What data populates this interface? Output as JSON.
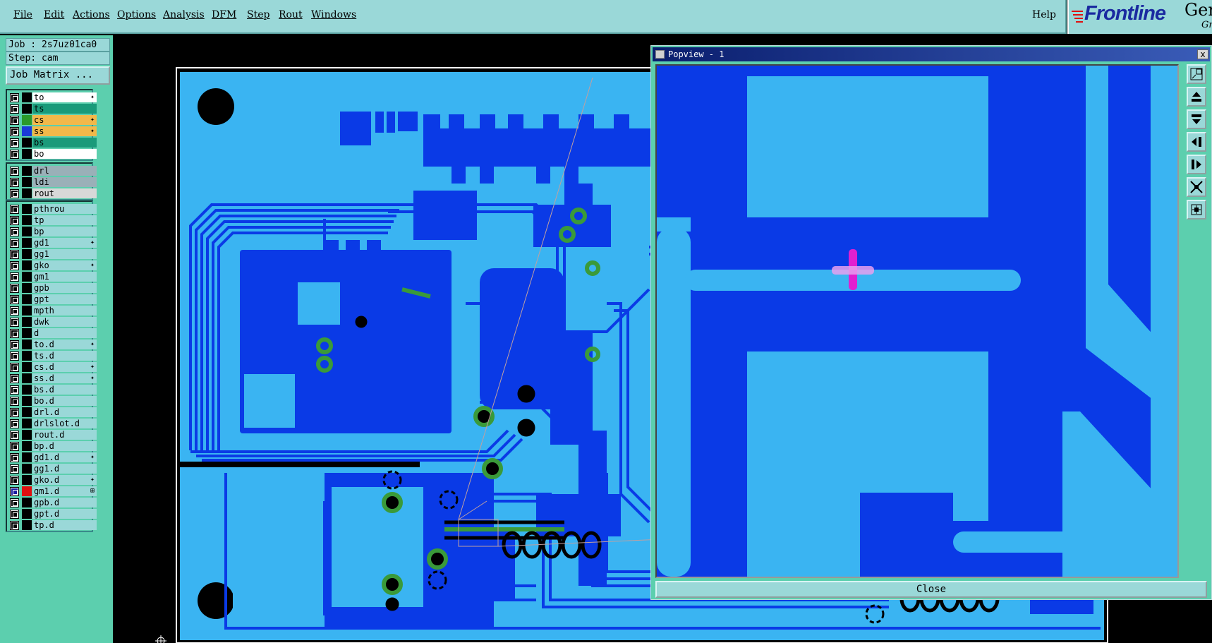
{
  "menu": {
    "items": [
      {
        "label": "File"
      },
      {
        "label": "Edit"
      },
      {
        "label": "Actions"
      },
      {
        "label": "Options"
      },
      {
        "label": "Analysis"
      },
      {
        "label": "DFM"
      },
      {
        "label": "Step"
      },
      {
        "label": "Rout"
      },
      {
        "label": "Windows"
      }
    ],
    "help": "Help"
  },
  "logo": {
    "brand": "Frontline",
    "product": "Ger",
    "sub": "Gr"
  },
  "job": {
    "job_label": "Job : 2s7uz01ca0",
    "step_label": "Step: cam",
    "matrix_button": "Job Matrix ..."
  },
  "layer_groups": [
    [
      {
        "name": "to",
        "color": "#ffffff",
        "swatch": "#000000",
        "mark": "✦"
      },
      {
        "name": "ts",
        "color": "#1a9a7a",
        "swatch": "#000000",
        "mark": ""
      },
      {
        "name": "cs",
        "color": "#f2b84a",
        "swatch": "#2a9a2a",
        "mark": "✦"
      },
      {
        "name": "ss",
        "color": "#f2b84a",
        "swatch": "#1a3ad8",
        "mark": "✦"
      },
      {
        "name": "bs",
        "color": "#1a9a7a",
        "swatch": "#000000",
        "mark": ""
      },
      {
        "name": "bo",
        "color": "#ffffff",
        "swatch": "#000000",
        "mark": ""
      }
    ],
    [
      {
        "name": "drl",
        "color": "#9ab0b8",
        "swatch": "#000000",
        "mark": ""
      },
      {
        "name": "ldi",
        "color": "#9ab0b8",
        "swatch": "#000000",
        "mark": ""
      },
      {
        "name": "rout",
        "color": "#d8d8d8",
        "swatch": "#000000",
        "mark": ""
      }
    ],
    [
      {
        "name": "pthrou",
        "color": "#9ad8d8",
        "swatch": "#000000",
        "mark": ""
      },
      {
        "name": "tp",
        "color": "#9ad8d8",
        "swatch": "#000000",
        "mark": ""
      },
      {
        "name": "bp",
        "color": "#9ad8d8",
        "swatch": "#000000",
        "mark": ""
      },
      {
        "name": "gd1",
        "color": "#9ad8d8",
        "swatch": "#000000",
        "mark": "✦"
      },
      {
        "name": "gg1",
        "color": "#9ad8d8",
        "swatch": "#000000",
        "mark": ""
      },
      {
        "name": "gko",
        "color": "#9ad8d8",
        "swatch": "#000000",
        "mark": "✦"
      },
      {
        "name": "gm1",
        "color": "#9ad8d8",
        "swatch": "#000000",
        "mark": ""
      },
      {
        "name": "gpb",
        "color": "#9ad8d8",
        "swatch": "#000000",
        "mark": ""
      },
      {
        "name": "gpt",
        "color": "#9ad8d8",
        "swatch": "#000000",
        "mark": ""
      },
      {
        "name": "mpth",
        "color": "#9ad8d8",
        "swatch": "#000000",
        "mark": ""
      },
      {
        "name": "dwk",
        "color": "#9ad8d8",
        "swatch": "#000000",
        "mark": ""
      },
      {
        "name": "d",
        "color": "#9ad8d8",
        "swatch": "#000000",
        "mark": ""
      },
      {
        "name": "to.d",
        "color": "#9ad8d8",
        "swatch": "#000000",
        "mark": "✦"
      },
      {
        "name": "ts.d",
        "color": "#9ad8d8",
        "swatch": "#000000",
        "mark": ""
      },
      {
        "name": "cs.d",
        "color": "#9ad8d8",
        "swatch": "#000000",
        "mark": "✦"
      },
      {
        "name": "ss.d",
        "color": "#9ad8d8",
        "swatch": "#000000",
        "mark": "✦"
      },
      {
        "name": "bs.d",
        "color": "#9ad8d8",
        "swatch": "#000000",
        "mark": ""
      },
      {
        "name": "bo.d",
        "color": "#9ad8d8",
        "swatch": "#000000",
        "mark": ""
      },
      {
        "name": "drl.d",
        "color": "#9ad8d8",
        "swatch": "#000000",
        "mark": ""
      },
      {
        "name": "drlslot.d",
        "color": "#9ad8d8",
        "swatch": "#000000",
        "mark": ""
      },
      {
        "name": "rout.d",
        "color": "#9ad8d8",
        "swatch": "#000000",
        "mark": ""
      },
      {
        "name": "bp.d",
        "color": "#9ad8d8",
        "swatch": "#000000",
        "mark": ""
      },
      {
        "name": "gd1.d",
        "color": "#9ad8d8",
        "swatch": "#000000",
        "mark": "✦"
      },
      {
        "name": "gg1.d",
        "color": "#9ad8d8",
        "swatch": "#000000",
        "mark": ""
      },
      {
        "name": "gko.d",
        "color": "#9ad8d8",
        "swatch": "#000000",
        "mark": "✦"
      },
      {
        "name": "gm1.d",
        "color": "#9ad8d8",
        "swatch": "#e01010",
        "mark": "⊞",
        "active": true
      },
      {
        "name": "gpb.d",
        "color": "#9ad8d8",
        "swatch": "#000000",
        "mark": ""
      },
      {
        "name": "gpt.d",
        "color": "#9ad8d8",
        "swatch": "#000000",
        "mark": ""
      },
      {
        "name": "tp.d",
        "color": "#9ad8d8",
        "swatch": "#000000",
        "mark": ""
      }
    ]
  ],
  "popview": {
    "title": "Popview - 1",
    "close_x": "x",
    "close_button": "Close",
    "tool_icons": [
      "zoom-fit-icon",
      "pan-up-icon",
      "pan-down-icon",
      "pan-left-icon",
      "pan-right-icon",
      "zoom-out-icon",
      "zoom-home-icon"
    ]
  },
  "colors": {
    "board_copper": "#0a3ae6",
    "board_substrate": "#3ab4f2",
    "pad_green": "#3a9a3a",
    "panel_bg": "#5ccfae",
    "menu_bg": "#9ad8d8",
    "cursor_magenta": "#e020d0"
  }
}
